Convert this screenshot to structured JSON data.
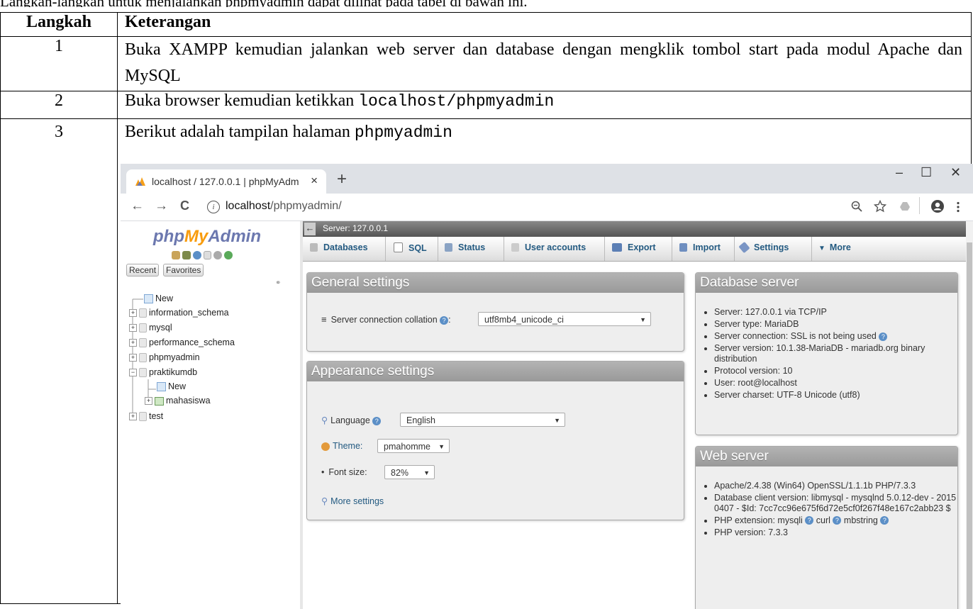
{
  "doc": {
    "top_line": "Langkah-langkah untuk menjalankan phpmyadmin dapat dilihat pada tabel di bawah ini.",
    "table": {
      "headers": [
        "Langkah",
        "Keterangan"
      ],
      "rows": [
        {
          "num": "1",
          "text": "Buka XAMPP kemudian jalankan web server dan database dengan mengklik tombol start pada modul Apache dan MySQL"
        },
        {
          "num": "2",
          "text": "Buka browser kemudian ketikkan ",
          "code": "localhost/phpmyadmin"
        },
        {
          "num": "3",
          "text": "Berikut adalah tampilan halaman ",
          "code": "phpmyadmin"
        }
      ]
    }
  },
  "browser": {
    "tab_title": "localhost / 127.0.0.1 | phpMyAdm",
    "tab_close": "×",
    "new_tab": "+",
    "win_min": "–",
    "win_max": "☐",
    "win_close": "✕",
    "url_host": "localhost",
    "url_path": "/phpmyadmin/",
    "nav_back": "←",
    "nav_forward": "→",
    "nav_reload": "C",
    "icons": [
      "zoom-icon",
      "star-icon",
      "drive-icon",
      "profile-icon",
      "menu-icon"
    ]
  },
  "pma": {
    "logo_php": "php",
    "logo_my": "My",
    "logo_admin": "Admin",
    "nav_tabs": [
      "Recent",
      "Favorites"
    ],
    "tree": [
      {
        "label": "New"
      },
      {
        "label": "information_schema"
      },
      {
        "label": "mysql"
      },
      {
        "label": "performance_schema"
      },
      {
        "label": "phpmyadmin"
      },
      {
        "label": "praktikumdb"
      },
      {
        "label": "New"
      },
      {
        "label": "mahasiswa"
      },
      {
        "label": "test"
      }
    ],
    "server_label": "Server: 127.0.0.1",
    "top_tabs": [
      "Databases",
      "SQL",
      "Status",
      "User accounts",
      "Export",
      "Import",
      "Settings",
      "More"
    ],
    "general": {
      "title": "General settings",
      "collation_label": "Server connection collation",
      "collation_value": "utf8mb4_unicode_ci"
    },
    "appearance": {
      "title": "Appearance settings",
      "language_label": "Language",
      "language_value": "English",
      "theme_label": "Theme:",
      "theme_value": "pmahomme",
      "font_label": "Font size:",
      "font_value": "82%",
      "more_settings": "More settings"
    },
    "db_server": {
      "title": "Database server",
      "items": [
        "Server: 127.0.0.1 via TCP/IP",
        "Server type: MariaDB",
        "Server connection: SSL is not being used",
        "Server version: 10.1.38-MariaDB - mariadb.org binary distribution",
        "Protocol version: 10",
        "User: root@localhost",
        "Server charset: UTF-8 Unicode (utf8)"
      ]
    },
    "web_server": {
      "title": "Web server",
      "items": [
        "Apache/2.4.38 (Win64) OpenSSL/1.1.1b PHP/7.3.3",
        "Database client version: libmysql - mysqlnd 5.0.12-dev - 20150407 - $Id: 7cc7cc96e675f6d72e5cf0f267f48e167c2abb23 $",
        "PHP extension: mysqli",
        "PHP version: 7.3.3"
      ],
      "ext_curl": "curl",
      "ext_mbstring": "mbstring"
    }
  }
}
